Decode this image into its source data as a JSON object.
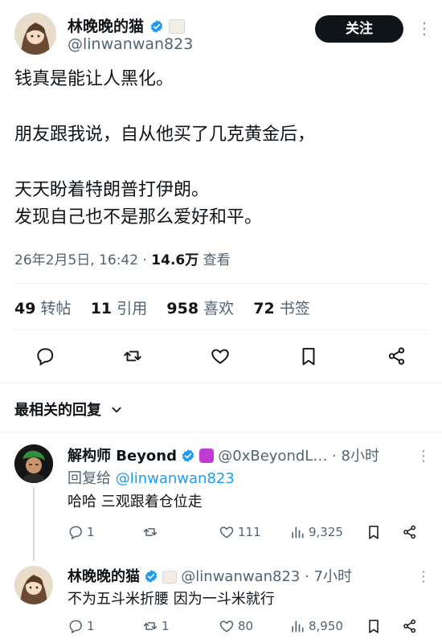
{
  "tweet": {
    "author_name": "林晚晚的猫",
    "author_handle": "@linwanwan823",
    "follow_label": "关注",
    "text_line1": "钱真是能让人黑化。",
    "text_line2": "朋友跟我说，自从他买了几克黄金后，",
    "text_line3": "天天盼着特朗普打伊朗。",
    "text_line4": "发现自己也不是那么爱好和平。",
    "date": "26年2月5日, 16:42 ·",
    "views": "14.6万",
    "views_label": "查看",
    "stats": {
      "reposts": "49",
      "reposts_label": "转帖",
      "quotes": "11",
      "quotes_label": "引用",
      "likes": "958",
      "likes_label": "喜欢",
      "bookmarks": "72",
      "bookmarks_label": "书签"
    }
  },
  "replies_header": "最相关的回复",
  "replies": [
    {
      "name": "解构师 Beyond",
      "handle": "@0xBeyondL… · 8小时",
      "reply_to_label": "回复给",
      "reply_to_handle": "@linwanwan823",
      "text": "哈哈 三观跟着仓位走",
      "comments": "1",
      "reposts": "",
      "likes": "111",
      "views": "9,325"
    },
    {
      "name": "林晚晚的猫",
      "handle": "@linwanwan823 · 7小时",
      "text": "不为五斗米折腰 因为一斗米就行",
      "comments": "1",
      "reposts": "1",
      "likes": "80",
      "views": "8,950"
    }
  ],
  "colors": {
    "accent": "#1d9bf0",
    "text": "#0f1419",
    "muted": "#536471"
  }
}
